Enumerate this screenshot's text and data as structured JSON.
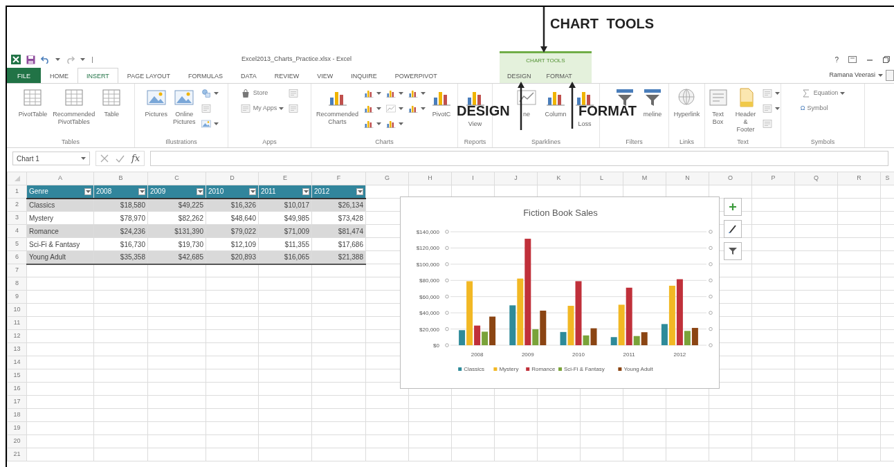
{
  "annotations": [
    {
      "kind": "top",
      "text": "CHART TOOLS"
    },
    {
      "kind": "left",
      "text": "DESIGN"
    },
    {
      "kind": "right",
      "text": "FORMAT"
    }
  ],
  "window": {
    "title": "Excel2013_Charts_Practice.xlsx - Excel",
    "help": "?",
    "user": "Ramana Veerasi"
  },
  "contextual_group": {
    "label": "CHART TOOLS"
  },
  "tabs": [
    {
      "label": "FILE",
      "kind": "file",
      "selected": false
    },
    {
      "label": "HOME",
      "kind": "tab",
      "selected": false
    },
    {
      "label": "INSERT",
      "kind": "tab",
      "selected": true
    },
    {
      "label": "PAGE LAYOUT",
      "kind": "tab",
      "selected": false
    },
    {
      "label": "FORMULAS",
      "kind": "tab",
      "selected": false
    },
    {
      "label": "DATA",
      "kind": "tab",
      "selected": false
    },
    {
      "label": "REVIEW",
      "kind": "tab",
      "selected": false
    },
    {
      "label": "VIEW",
      "kind": "tab",
      "selected": false
    },
    {
      "label": "INQUIRE",
      "kind": "tab",
      "selected": false
    },
    {
      "label": "POWERPIVOT",
      "kind": "tab",
      "selected": false
    },
    {
      "label": "DESIGN",
      "kind": "context",
      "selected": false
    },
    {
      "label": "FORMAT",
      "kind": "context",
      "selected": false
    }
  ],
  "ribbon": {
    "groups": [
      {
        "label": "Tables",
        "items": [
          {
            "kind": "large",
            "label": "PivotTable"
          },
          {
            "kind": "large",
            "label": "Recommended\nPivotTables"
          },
          {
            "kind": "large",
            "label": "Table"
          }
        ]
      },
      {
        "label": "Illustrations",
        "items": [
          {
            "kind": "large",
            "label": "Pictures"
          },
          {
            "kind": "large",
            "label": "Online\nPictures"
          },
          {
            "kind": "stack",
            "items": [
              {
                "caret": true
              },
              {
                "caret": false
              },
              {
                "caret": true
              }
            ]
          }
        ]
      },
      {
        "label": "Apps",
        "items": [
          {
            "kind": "stack",
            "items": [
              {
                "label": "Store",
                "caret": false
              },
              {
                "label": "My Apps",
                "caret": true
              }
            ]
          },
          {
            "kind": "stack",
            "items": [
              {
                "caret": false
              },
              {
                "caret": false
              }
            ]
          }
        ]
      },
      {
        "label": "Charts",
        "items": [
          {
            "kind": "large",
            "label": "Recommended\nCharts"
          },
          {
            "kind": "stack",
            "items": [
              {
                "caret": true
              },
              {
                "caret": true
              },
              {
                "caret": true
              }
            ]
          },
          {
            "kind": "stack",
            "items": [
              {
                "caret": true
              },
              {
                "caret": true
              },
              {
                "caret": true
              }
            ]
          },
          {
            "kind": "stack",
            "items": [
              {
                "caret": true
              },
              {
                "caret": true
              }
            ]
          },
          {
            "kind": "large",
            "label": "PivotC"
          }
        ]
      },
      {
        "label": "Reports",
        "items": [
          {
            "kind": "large",
            "label": "View"
          }
        ]
      },
      {
        "label": "Sparklines",
        "items": [
          {
            "kind": "large",
            "label": "ne"
          },
          {
            "kind": "large",
            "label": "Column"
          },
          {
            "kind": "large",
            "label": "Loss"
          }
        ]
      },
      {
        "label": "Filters",
        "items": [
          {
            "kind": "large"
          },
          {
            "kind": "large",
            "label": "meline"
          }
        ]
      },
      {
        "label": "Links",
        "items": [
          {
            "kind": "large",
            "label": "Hyperlink"
          }
        ]
      },
      {
        "label": "Text",
        "items": [
          {
            "kind": "large",
            "label": "Text\nBox"
          },
          {
            "kind": "large",
            "label": "Header\n& Footer"
          },
          {
            "kind": "stack",
            "items": [
              {
                "caret": true
              },
              {
                "caret": true
              },
              {
                "caret": false
              }
            ]
          }
        ]
      },
      {
        "label": "Symbols",
        "items": [
          {
            "kind": "stack",
            "items": [
              {
                "label": "Equation",
                "caret": true
              },
              {
                "glyph": "Ω",
                "label": "Symbol",
                "caret": false
              }
            ]
          }
        ]
      }
    ]
  },
  "formula_bar": {
    "name_box": "Chart 1",
    "function_label": "fx"
  },
  "sheet": {
    "columns": [
      "A",
      "B",
      "C",
      "D",
      "E",
      "F",
      "G",
      "H",
      "I",
      "J",
      "K",
      "L",
      "M",
      "N",
      "O",
      "P",
      "Q",
      "R",
      "S"
    ],
    "rows": [
      "1",
      "2",
      "3",
      "4",
      "5",
      "6",
      "7",
      "8",
      "9",
      "10",
      "11",
      "12",
      "13",
      "14",
      "15",
      "16",
      "17",
      "18",
      "19",
      "20",
      "21"
    ],
    "table": {
      "header": [
        "Genre",
        "2008",
        "2009",
        "2010",
        "2011",
        "2012"
      ],
      "rows": [
        [
          "Classics",
          "$18,580",
          "$49,225",
          "$16,326",
          "$10,017",
          "$26,134"
        ],
        [
          "Mystery",
          "$78,970",
          "$82,262",
          "$48,640",
          "$49,985",
          "$73,428"
        ],
        [
          "Romance",
          "$24,236",
          "$131,390",
          "$79,022",
          "$71,009",
          "$81,474"
        ],
        [
          "Sci-Fi & Fantasy",
          "$16,730",
          "$19,730",
          "$12,109",
          "$11,355",
          "$17,686"
        ],
        [
          "Young Adult",
          "$35,358",
          "$42,685",
          "$20,893",
          "$16,065",
          "$21,388"
        ]
      ]
    },
    "chart": {
      "chart_data": {
        "type": "bar",
        "title": "Fiction Book Sales",
        "categories": [
          "2008",
          "2009",
          "2010",
          "2011",
          "2012"
        ],
        "series": [
          {
            "name": "Classics",
            "color": "#2e8b9a",
            "values": [
              18580,
              49225,
              16326,
              10017,
              26134
            ]
          },
          {
            "name": "Mystery",
            "color": "#f2b824",
            "values": [
              78970,
              82262,
              48640,
              49985,
              73428
            ]
          },
          {
            "name": "Romance",
            "color": "#c0303a",
            "values": [
              24236,
              131390,
              79022,
              71009,
              81474
            ]
          },
          {
            "name": "Sci-Fi & Fantasy",
            "color": "#7aa33a",
            "values": [
              16730,
              19730,
              12109,
              11355,
              17686
            ]
          },
          {
            "name": "Young Adult",
            "color": "#8b4513",
            "values": [
              35358,
              42685,
              20893,
              16065,
              21388
            ]
          }
        ],
        "ylim": [
          0,
          140000
        ],
        "grid": true,
        "legend": true,
        "yticks": [
          {
            "value": 0,
            "label": "$0"
          },
          {
            "value": 20000,
            "label": "$20,000"
          },
          {
            "value": 40000,
            "label": "$40,000"
          },
          {
            "value": 60000,
            "label": "$60,000"
          },
          {
            "value": 80000,
            "label": "$80,000"
          },
          {
            "value": 100000,
            "label": "$100,000"
          },
          {
            "value": 120000,
            "label": "$120,000"
          },
          {
            "value": 140000,
            "label": "$140,000"
          }
        ]
      }
    }
  }
}
